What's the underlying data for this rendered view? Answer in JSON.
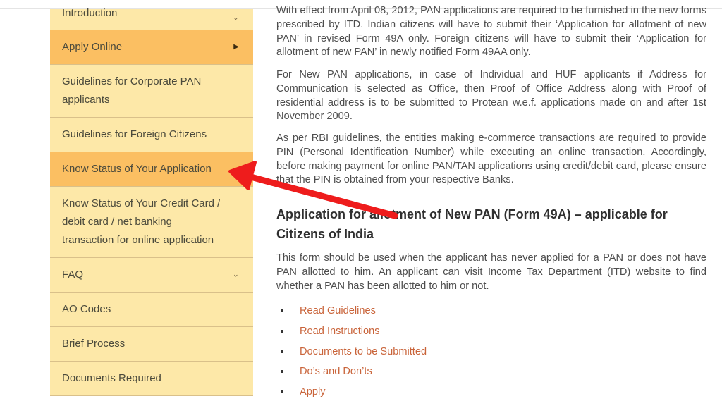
{
  "sidebar": {
    "items": [
      {
        "label": "Introduction",
        "icon": "chevron-down-icon",
        "active": false
      },
      {
        "label": "Apply Online",
        "icon": "caret-right-icon",
        "active": true
      },
      {
        "label": "Guidelines for Corporate PAN applicants",
        "icon": null,
        "active": false
      },
      {
        "label": "Guidelines for Foreign Citizens",
        "icon": null,
        "active": false
      },
      {
        "label": "Know Status of Your Application",
        "icon": null,
        "active": true
      },
      {
        "label": "Know Status of Your Credit Card / debit card / net banking transaction for online application",
        "icon": null,
        "active": false
      },
      {
        "label": "FAQ",
        "icon": "chevron-down-icon",
        "active": false
      },
      {
        "label": "AO Codes",
        "icon": null,
        "active": false
      },
      {
        "label": "Brief Process",
        "icon": null,
        "active": false
      },
      {
        "label": "Documents Required",
        "icon": null,
        "active": false
      }
    ],
    "icons": {
      "chevron_down": "⌄",
      "caret_right": "▶"
    }
  },
  "content": {
    "paragraphs": [
      "With effect from April 08, 2012, PAN applications are required to be furnished in the new forms prescribed by ITD. Indian citizens will have to submit their ‘Application for allotment of new PAN’ in revised Form 49A only. Foreign citizens will have to submit their ‘Application for allotment of new PAN’ in newly notified Form 49AA only.",
      "For New PAN applications, in case of Individual and HUF applicants if Address for Communication is selected as Office, then Proof of Office Address along with Proof of residential address is to be submitted to Protean w.e.f. applications made on and after 1st November 2009.",
      "As per RBI guidelines, the entities making e-commerce transactions are required to provide PIN (Personal Identification Number) while executing an online transaction. Accordingly, before making payment for online PAN/TAN applications using credit/debit card, please ensure that the PIN is obtained from your respective Banks."
    ],
    "section_heading": "Application for allotment of New PAN (Form 49A) – applicable for Citizens of India",
    "section_text": "This form should be used when the applicant has never applied for a PAN or does not have PAN allotted to him. An applicant can visit Income Tax Department (ITD) website to find whether a PAN has been allotted to him or not.",
    "links": [
      "Read Guidelines",
      "Read Instructions",
      "Documents to be Submitted",
      "Do’s and Don’ts",
      "Apply"
    ]
  },
  "annotation": {
    "type": "red-arrow",
    "color": "#ee1c1c",
    "points_to": "Know Status of Your Application"
  }
}
